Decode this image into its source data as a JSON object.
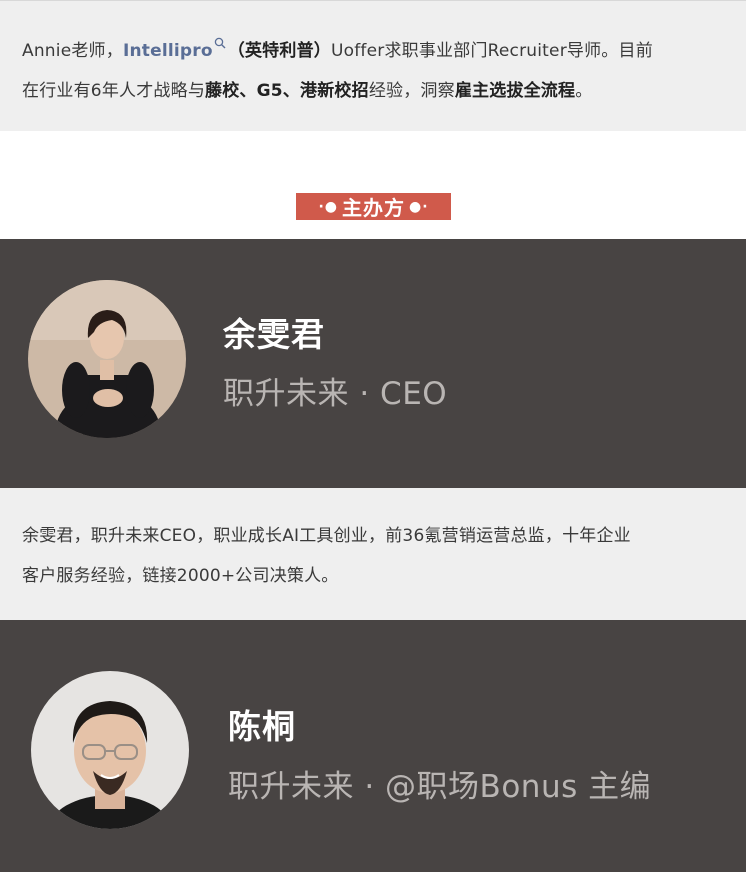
{
  "intro_bio": {
    "prefix": "Annie老师，",
    "company_link": "Intellipro",
    "company_cn": "（英特利普）",
    "rest_line1": "Uoffer求职事业部门Recruiter导师。目前",
    "line2_a": "在行业有6年人才战略与",
    "line2_bold1": "藤校、G5、港新校招",
    "line2_b": "经验，洞察",
    "line2_bold2": "雇主选拔全流程",
    "line2_end": "。"
  },
  "organizer_tag": {
    "left_dots": "·●",
    "label": "主办方",
    "right_dots": "●·"
  },
  "speakers": [
    {
      "name": "余雯君",
      "title": "职升未来 · CEO",
      "avatar_icon": "woman-portrait"
    },
    {
      "name": "陈桐",
      "title": "职升未来 · @职场Bonus 主编",
      "avatar_icon": "man-portrait"
    }
  ],
  "speaker1_bio": {
    "line1": "余雯君，职升未来CEO，职业成长AI工具创业，前36氪营销运营总监，十年企业",
    "line2": "客户服务经验，链接2000+公司决策人。"
  },
  "colors": {
    "card_bg": "#484443",
    "bio_bg": "#efefef",
    "tag_bg": "#d05a4b",
    "link": "#5a6e96"
  }
}
